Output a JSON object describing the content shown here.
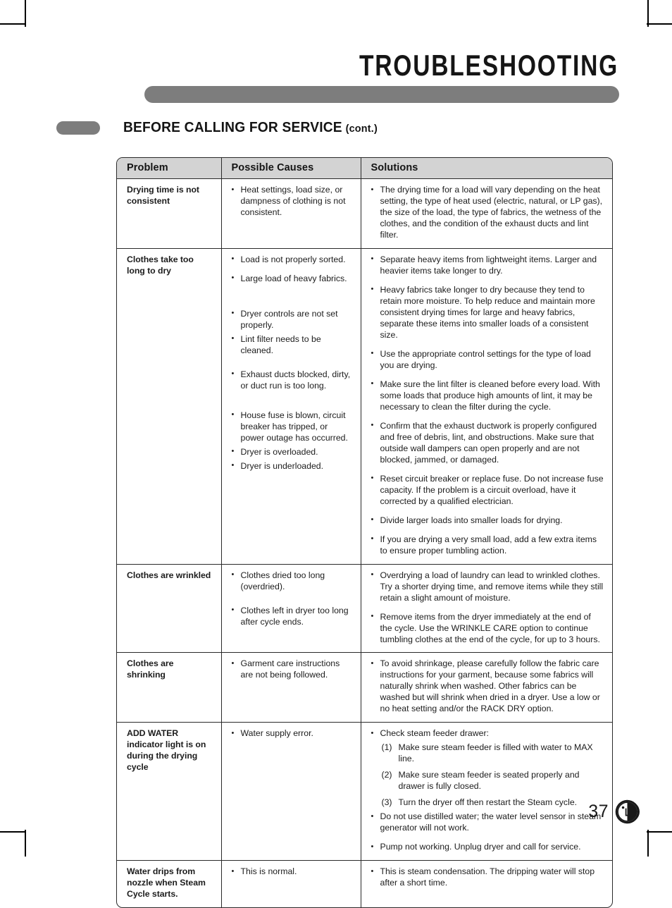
{
  "page": {
    "title": "TROUBLESHOOTING",
    "section_title": "BEFORE CALLING FOR SERVICE",
    "section_cont": "(cont.)",
    "page_number": "37",
    "brand": "LG"
  },
  "table": {
    "headers": {
      "problem": "Problem",
      "causes": "Possible Causes",
      "solutions": "Solutions"
    },
    "rows": [
      {
        "problem": "Drying time is not consistent",
        "causes": [
          "Heat settings, load size, or dampness of clothing is not consistent."
        ],
        "solutions": [
          "The drying time for a load will vary depending on the heat setting, the type of heat used (electric, natural, or LP gas), the size of the load, the type of fabrics, the wetness of the clothes, and the condition of the exhaust ducts and lint filter."
        ]
      },
      {
        "problem": "Clothes take too long to dry",
        "causes": [
          "Load is not properly sorted.",
          "Large load of heavy fabrics.",
          "Dryer controls are not set properly.",
          "Lint filter needs to be cleaned.",
          "Exhaust ducts blocked, dirty, or duct run is too long.",
          "House fuse is blown, circuit breaker has tripped, or power outage has occurred.",
          "Dryer is overloaded.",
          "Dryer is underloaded."
        ],
        "solutions": [
          "Separate heavy items from lightweight items. Larger and heavier items take longer to dry.",
          "Heavy fabrics take longer to dry because they tend to retain more moisture. To help reduce and maintain more consistent drying times for large and heavy fabrics, separate these items into smaller loads of a consistent size.",
          "Use the appropriate control settings for the type of load you are drying.",
          "Make sure the lint filter is cleaned before every load. With some loads that produce high amounts of lint, it may be necessary to clean the filter during the cycle.",
          "Confirm that the exhaust ductwork is properly configured and free of debris, lint, and obstructions. Make sure that outside wall dampers can open properly and are not blocked, jammed, or damaged.",
          "Reset circuit breaker or replace fuse. Do not increase fuse capacity. If the problem is a circuit overload, have it corrected by a qualified electrician.",
          "Divide larger loads into smaller loads for drying.",
          "If you are drying a very small load, add a few extra items to ensure proper tumbling action."
        ]
      },
      {
        "problem": "Clothes are wrinkled",
        "causes": [
          "Clothes dried too long (overdried).",
          "Clothes left in dryer too long after cycle ends."
        ],
        "solutions": [
          "Overdrying a load of laundry can lead to wrinkled clothes. Try a shorter drying time, and remove items while they still retain a slight amount of moisture.",
          "Remove items from the dryer immediately at the end of the cycle. Use the WRINKLE CARE option to continue tumbling clothes at the end of the cycle, for up to 3 hours."
        ]
      },
      {
        "problem": "Clothes are shrinking",
        "causes": [
          "Garment care instructions are not being followed."
        ],
        "solutions": [
          "To avoid shrinkage, please carefully follow the fabric care instructions for your garment, because some fabrics will naturally shrink when washed. Other fabrics can be washed but will shrink when dried in a dryer. Use a low or no heat setting and/or the RACK DRY option."
        ]
      },
      {
        "problem": "ADD WATER indicator light is on during the drying cycle",
        "causes": [
          "Water supply error."
        ],
        "solutions": [
          "Check steam feeder drawer:",
          "Do not use distilled water; the water level sensor in steam generator will not work.",
          "Pump not working. Unplug dryer and call for service."
        ],
        "numbered": [
          {
            "num": "(1)",
            "text": "Make sure steam feeder is filled with water to MAX line."
          },
          {
            "num": "(2)",
            "text": "Make sure steam feeder is seated properly and drawer is fully closed."
          },
          {
            "num": "(3)",
            "text": "Turn the dryer off then restart the Steam cycle."
          }
        ]
      },
      {
        "problem": "Water drips from nozzle when Steam Cycle starts.",
        "causes": [
          "This is normal."
        ],
        "solutions": [
          "This is steam condensation. The dripping water will stop after a short time."
        ]
      }
    ]
  }
}
